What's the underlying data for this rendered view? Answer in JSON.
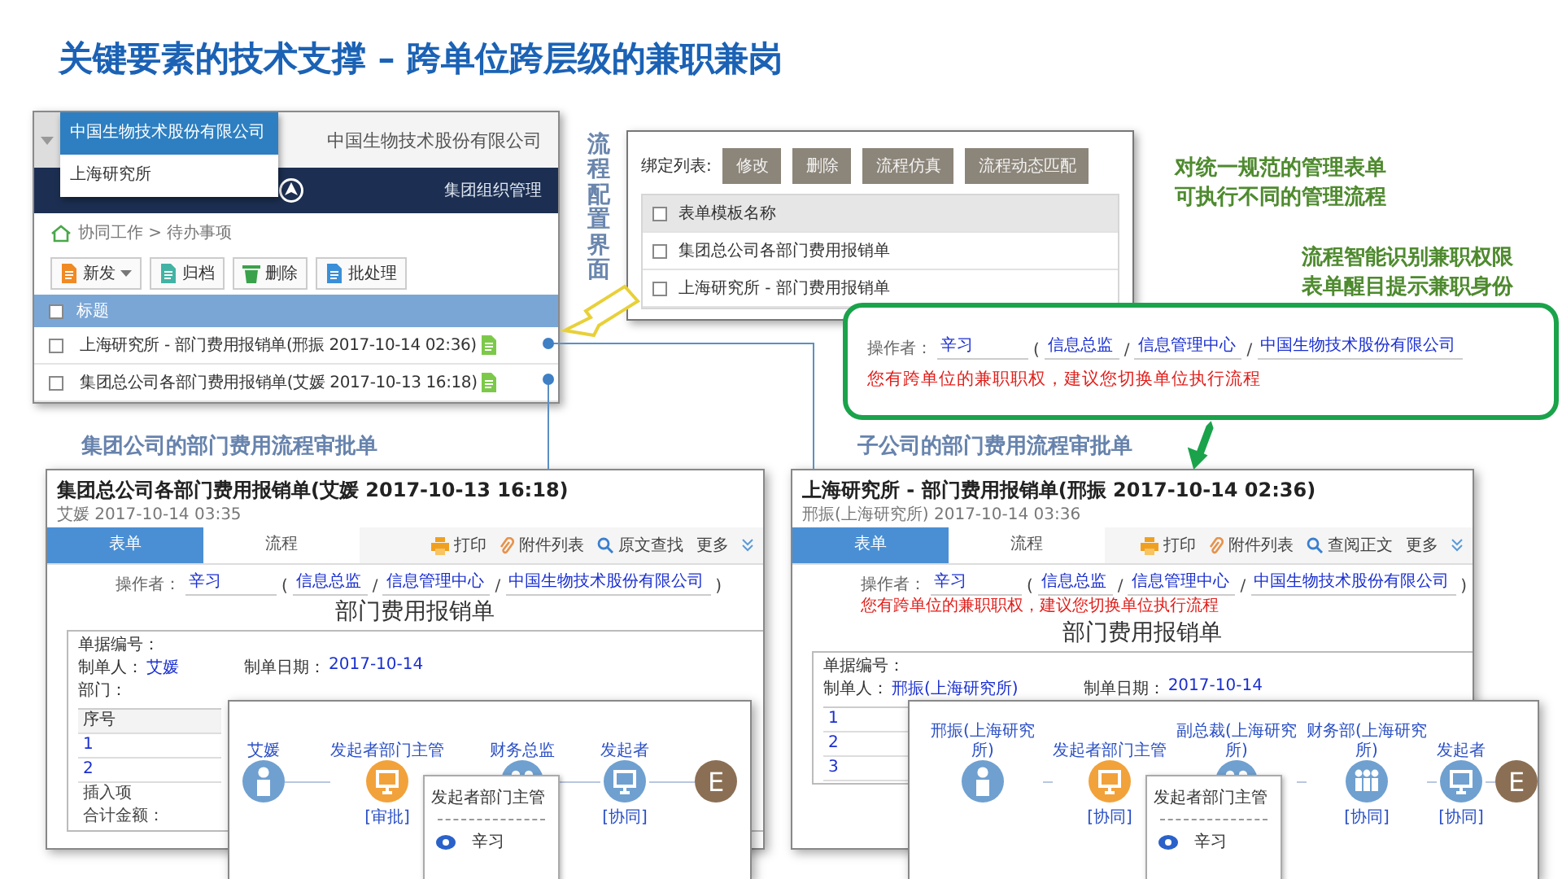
{
  "title": "关键要素的技术支撑 – 跨单位跨层级的兼职兼岗",
  "todo_window": {
    "units": [
      {
        "label": "中国生物技术股份有限公司",
        "selected": true
      },
      {
        "label": "上海研究所",
        "selected": false
      }
    ],
    "company": "中国生物技术股份有限公司",
    "nav_item": "集团组织管理",
    "breadcrumb": "协同工作 > 待办事项",
    "toolbar": [
      {
        "label": "新发",
        "kind": "dropdown"
      },
      {
        "label": "归档",
        "kind": "plain"
      },
      {
        "label": "删除",
        "kind": "plain"
      },
      {
        "label": "批处理",
        "kind": "plain"
      }
    ],
    "column": "标题",
    "header_checked": false,
    "rows": [
      {
        "title": "上海研究所 - 部门费用报销单(邢振 2017-10-14 02:36)",
        "checked": false
      },
      {
        "title": "集团总公司各部门费用报销单(艾媛 2017-10-13 16:18)",
        "checked": false
      }
    ]
  },
  "config_caption": "流程配置界面",
  "config_window": {
    "label": "绑定列表:",
    "buttons": [
      "修改",
      "删除",
      "流程仿真",
      "流程动态匹配"
    ],
    "column": "表单模板名称",
    "header_checked": false,
    "rows": [
      {
        "name": "集团总公司各部门费用报销单",
        "checked": false
      },
      {
        "name": "上海研究所 - 部门费用报销单",
        "checked": false
      }
    ]
  },
  "notes": [
    {
      "lines": [
        "对统一规范的管理表单",
        "可执行不同的管理流程"
      ]
    },
    {
      "lines": [
        "流程智能识别兼职权限",
        "表单醒目提示兼职身份"
      ]
    }
  ],
  "alert": {
    "operator": {
      "label": "操作者：",
      "value": "辛习",
      "fields": [
        {
          "prefix": "(",
          "value": "信息总监"
        },
        {
          "prefix": "/",
          "value": "信息管理中心"
        },
        {
          "prefix": "/",
          "value": "中国生物技术股份有限公司"
        }
      ]
    },
    "warning": "您有跨单位的兼职职权，建议您切换单位执行流程"
  },
  "captions": [
    "集团公司的部门费用流程审批单",
    "子公司的部门费用流程审批单"
  ],
  "forms": [
    {
      "title": "集团总公司各部门费用报销单(艾媛 2017-10-13 16:18)",
      "subtitle": "艾媛  2017-10-14 03:35",
      "tabs": [
        {
          "label": "表单",
          "selected": true
        },
        {
          "label": "流程",
          "selected": false
        }
      ],
      "actions": [
        "打印",
        "附件列表",
        "原文查找",
        "更多"
      ],
      "operator": {
        "label": "操作者：",
        "value": "辛习",
        "fields": [
          {
            "prefix": "(",
            "value": "信息总监"
          },
          {
            "prefix": "/",
            "value": "信息管理中心"
          },
          {
            "prefix": "/",
            "value": "中国生物技术股份有限公司"
          }
        ],
        "suffix": ")"
      },
      "heading": "部门费用报销单",
      "sheet": [
        [
          {
            "label": "单据编号："
          }
        ],
        [
          {
            "label": "制单人：",
            "value": "艾媛"
          },
          {
            "label": "制单日期：",
            "value": "2017-10-14"
          }
        ],
        [
          {
            "label": "部门："
          }
        ]
      ],
      "table": {
        "column": "序号",
        "rows": [
          "1",
          "2"
        ]
      },
      "footer": [
        "插入项",
        "合计金额："
      ]
    },
    {
      "title": "上海研究所 - 部门费用报销单(邢振 2017-10-14 02:36)",
      "subtitle": "邢振(上海研究所)  2017-10-14 03:36",
      "tabs": [
        {
          "label": "表单",
          "selected": true
        },
        {
          "label": "流程",
          "selected": false
        }
      ],
      "actions": [
        "打印",
        "附件列表",
        "查阅正文",
        "更多"
      ],
      "operator": {
        "label": "操作者：",
        "value": "辛习",
        "fields": [
          {
            "prefix": "(",
            "value": "信息总监"
          },
          {
            "prefix": "/",
            "value": "信息管理中心"
          },
          {
            "prefix": "/",
            "value": "中国生物技术股份有限公司"
          }
        ],
        "suffix": ")"
      },
      "warning": "您有跨单位的兼职职权，建议您切换单位执行流程",
      "heading": "部门费用报销单",
      "sheet": [
        [
          {
            "label": "单据编号："
          }
        ],
        [
          {
            "label": "制单人：",
            "value": "邢振(上海研究所)"
          },
          {
            "label": "制单日期：",
            "value": "2017-10-14"
          }
        ]
      ],
      "table": {
        "rows": [
          "1",
          "2",
          "3"
        ]
      }
    }
  ],
  "flows": [
    {
      "nodes": [
        {
          "label": "艾媛",
          "kind": "person",
          "current": false
        },
        {
          "label": "发起者部门主管",
          "kind": "screen",
          "current": true,
          "status": "[审批]"
        },
        {
          "label": "财务总监",
          "kind": "group",
          "current": false
        },
        {
          "label": "发起者",
          "kind": "screen",
          "current": false,
          "status": "[协同]"
        },
        {
          "label": "E",
          "kind": "end",
          "current": false
        }
      ],
      "popup": {
        "title": "发起者部门主管",
        "person": "辛习"
      }
    },
    {
      "nodes": [
        {
          "label": "邢振(上海研究所)",
          "kind": "person",
          "current": false
        },
        {
          "label": "发起者部门主管",
          "kind": "screen",
          "current": true,
          "status": "[协同]"
        },
        {
          "label": "副总裁(上海研究所)",
          "kind": "group",
          "current": false
        },
        {
          "label": "财务部(上海研究所)",
          "kind": "people",
          "current": false,
          "status": "[协同]"
        },
        {
          "label": "发起者",
          "kind": "screen",
          "current": false,
          "status": "[协同]"
        },
        {
          "label": "E",
          "kind": "end",
          "current": false
        }
      ],
      "popup": {
        "title": "发起者部门主管",
        "person": "辛习"
      }
    }
  ]
}
